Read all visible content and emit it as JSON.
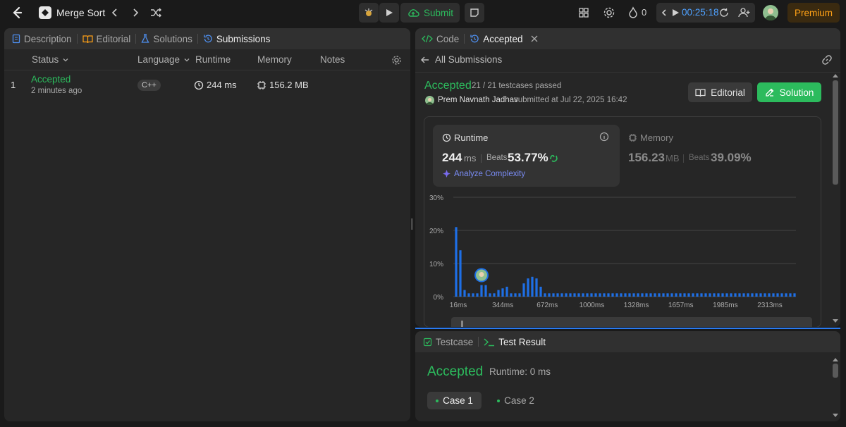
{
  "topbar": {
    "problem_title": "Merge Sort",
    "submit_label": "Submit",
    "streak_count": "0",
    "timer": "00:25:18",
    "premium_label": "Premium"
  },
  "left": {
    "tabs": [
      "Description",
      "Editorial",
      "Solutions",
      "Submissions"
    ],
    "columns": [
      "Status",
      "Language",
      "Runtime",
      "Memory",
      "Notes"
    ],
    "rows": [
      {
        "index": "1",
        "status": "Accepted",
        "time_ago": "2 minutes ago",
        "language": "C++",
        "runtime": "244 ms",
        "memory": "156.2 MB"
      }
    ]
  },
  "right": {
    "tabs": [
      "Code",
      "Accepted"
    ],
    "back_label": "All Submissions",
    "status": "Accepted",
    "testcases": "21 / 21 testcases passed",
    "author": "Prem Navnath Jadhav",
    "submitted_text": "submitted at Jul 22, 2025 16:42",
    "editorial_label": "Editorial",
    "solution_label": "Solution",
    "runtime": {
      "label": "Runtime",
      "value": "244",
      "unit": "ms",
      "beats_label": "Beats",
      "beats": "53.77%",
      "analyze_label": "Analyze Complexity"
    },
    "memory": {
      "label": "Memory",
      "value": "156.23",
      "unit": "MB",
      "beats_label": "Beats",
      "beats": "39.09%"
    }
  },
  "chart_data": {
    "type": "bar",
    "yticks": [
      "30%",
      "20%",
      "10%",
      "0%"
    ],
    "ylim": [
      0,
      30
    ],
    "xticks": [
      "16ms",
      "344ms",
      "672ms",
      "1000ms",
      "1328ms",
      "1657ms",
      "1985ms",
      "2313ms"
    ],
    "values": [
      21,
      14,
      2,
      1,
      1,
      1,
      3.5,
      3.5,
      1,
      1,
      2,
      2.5,
      3,
      1,
      1,
      1,
      4,
      5.5,
      6,
      5.5,
      3,
      1,
      1,
      1,
      1,
      1,
      1,
      1,
      1,
      1,
      1,
      1,
      1,
      1,
      1,
      1,
      1,
      1,
      1,
      1,
      1,
      1,
      1,
      1,
      1,
      1,
      1,
      1,
      1,
      1,
      1,
      1,
      1,
      1,
      1,
      1,
      1,
      1,
      1,
      1,
      1,
      1,
      1,
      1,
      1,
      1,
      1,
      1,
      1,
      1,
      1,
      1,
      1,
      1,
      1,
      1,
      1,
      1,
      1,
      1,
      1
    ],
    "highlight_index": 6,
    "bar_color": "#1e6fe6"
  },
  "bottom": {
    "tabs": [
      "Testcase",
      "Test Result"
    ],
    "status": "Accepted",
    "runtime_text": "Runtime: 0 ms",
    "cases": [
      "Case 1",
      "Case 2"
    ]
  }
}
